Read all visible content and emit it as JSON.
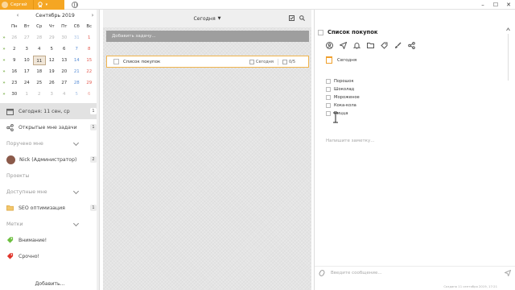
{
  "titlebar": {
    "user_name": "Сергей"
  },
  "calendar": {
    "month": "Сентябрь 2019",
    "weekdays": [
      "Пн",
      "Вт",
      "Ср",
      "Чт",
      "Пт",
      "Сб",
      "Вс"
    ],
    "weeks": [
      [
        "26",
        "27",
        "28",
        "29",
        "30",
        "31",
        "1"
      ],
      [
        "2",
        "3",
        "4",
        "5",
        "6",
        "7",
        "8"
      ],
      [
        "9",
        "10",
        "11",
        "12",
        "13",
        "14",
        "15"
      ],
      [
        "16",
        "17",
        "18",
        "19",
        "20",
        "21",
        "22"
      ],
      [
        "23",
        "24",
        "25",
        "26",
        "27",
        "28",
        "29"
      ],
      [
        "30",
        "1",
        "2",
        "3",
        "4",
        "5",
        "6"
      ]
    ],
    "selected_day": "11"
  },
  "sidebar": {
    "today": {
      "label": "Сегодня: 11 сен, ср",
      "count": "1"
    },
    "shared": {
      "label": "Открытые мне задачи",
      "count": "1"
    },
    "assigned_section": "Поручено мне",
    "assignee": {
      "label": "Nick (Администратор)",
      "count": "2"
    },
    "projects_section": "Проекты",
    "available_section": "Доступные мне",
    "seo": {
      "label": "SEO оптимизация",
      "count": "1"
    },
    "tags_section": "Метки",
    "tag1": "Внимание!",
    "tag2": "Срочно!",
    "add_label": "Добавить..."
  },
  "middle": {
    "header": "Сегодня",
    "add_task_placeholder": "Добавить задачу...",
    "task": {
      "title": "Список покупок",
      "date": "Сегодня",
      "progress": "0/5"
    }
  },
  "right": {
    "title": "Список покупок",
    "date": "Сегодня",
    "checklist": [
      "Порошок",
      "Шоколад",
      "Мороженое",
      "Кока-кола",
      "Пицца"
    ],
    "note_placeholder": "Напишите заметку...",
    "message_placeholder": "Введите сообщение...",
    "created": "Создано 11 сентября 2019, 17:21"
  },
  "colors": {
    "accent": "#f5a623",
    "week_marker": "#6ca636",
    "saturday": "#5b8fd6",
    "sunday": "#e45a4f"
  }
}
